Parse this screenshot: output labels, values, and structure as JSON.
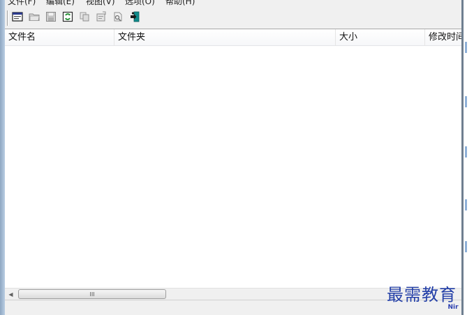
{
  "menu": {
    "items": [
      {
        "label": "文件(F)"
      },
      {
        "label": "编辑(E)"
      },
      {
        "label": "视图(V)"
      },
      {
        "label": "选项(O)"
      },
      {
        "label": "帮助(H)"
      }
    ]
  },
  "toolbar": {
    "buttons": [
      {
        "icon": "html-report-icon"
      },
      {
        "icon": "open-folder-icon"
      },
      {
        "icon": "save-icon"
      },
      {
        "icon": "refresh-icon"
      },
      {
        "icon": "copy-icon"
      },
      {
        "icon": "properties-icon"
      },
      {
        "icon": "find-icon"
      },
      {
        "icon": "exit-icon"
      }
    ]
  },
  "listview": {
    "columns": [
      {
        "label": "文件名"
      },
      {
        "label": "文件夹"
      },
      {
        "label": "大小"
      },
      {
        "label": "修改时间"
      }
    ],
    "rows": []
  },
  "scrollbar": {
    "thumb_grip": "III"
  },
  "statusbar": {
    "text": "",
    "brand": "Nir"
  },
  "watermark": {
    "text": "最需教育"
  }
}
